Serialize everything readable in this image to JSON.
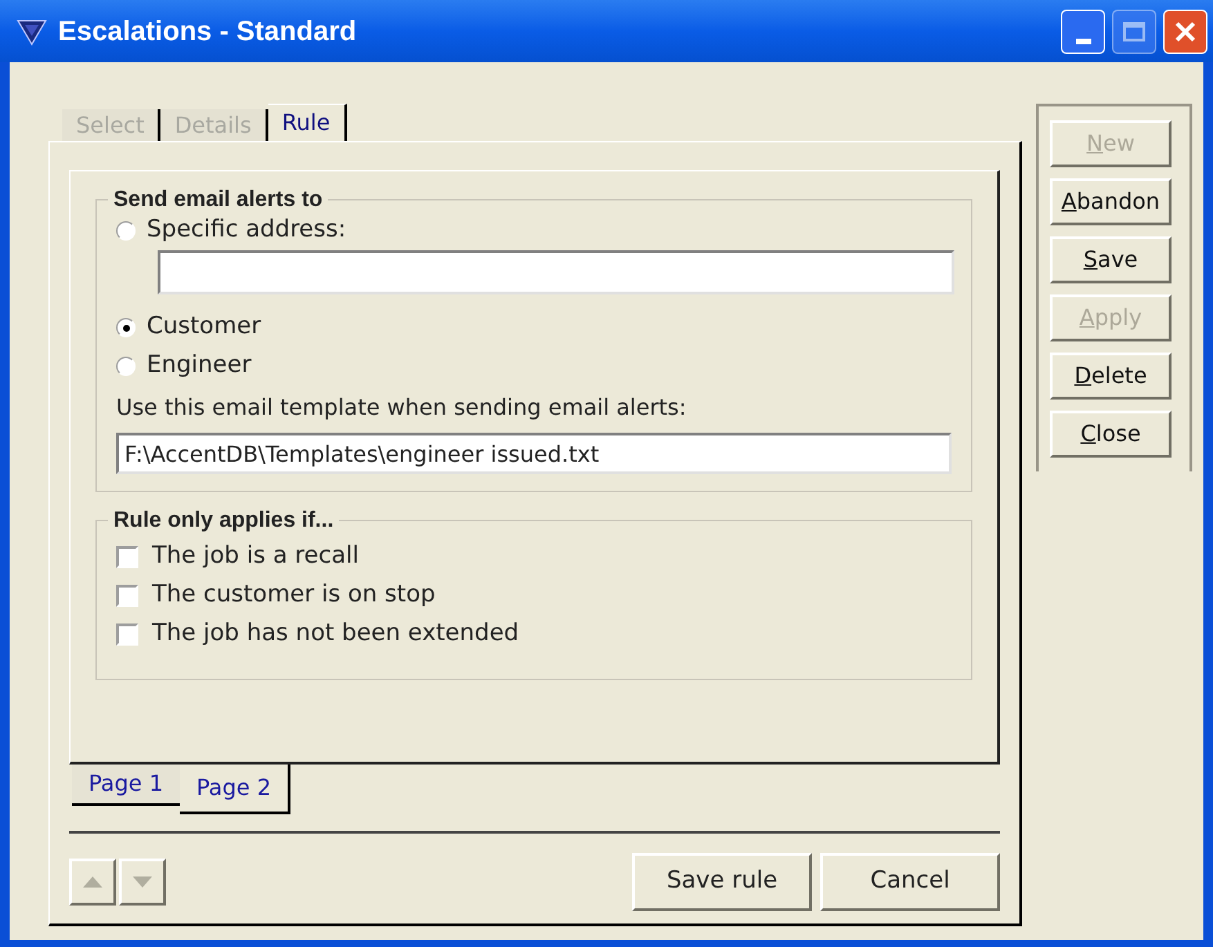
{
  "window": {
    "title": "Escalations - Standard"
  },
  "tabs": [
    {
      "label": "Select",
      "selected": false,
      "disabled": true
    },
    {
      "label": "Details",
      "selected": false,
      "disabled": true
    },
    {
      "label": "Rule",
      "selected": true,
      "disabled": false
    }
  ],
  "send_group": {
    "title": "Send email alerts to",
    "options": [
      {
        "label": "Specific address:",
        "selected": false
      },
      {
        "label": "Customer",
        "selected": true
      },
      {
        "label": "Engineer",
        "selected": false
      }
    ],
    "template_label": "Use this email template when sending email alerts:",
    "template_value": "F:\\AccentDB\\Templates\\engineer issued.txt"
  },
  "rule_group": {
    "title": "Rule only applies if...",
    "conditions": [
      {
        "label": "The job is a recall",
        "checked": false
      },
      {
        "label": "The customer is on stop",
        "checked": false
      },
      {
        "label": "The job has not been extended",
        "checked": false
      }
    ]
  },
  "page_tabs": [
    {
      "label": "Page 1",
      "selected": false
    },
    {
      "label": "Page 2",
      "selected": true
    }
  ],
  "bottom_buttons": [
    "Save rule",
    "Cancel"
  ],
  "side_buttons": [
    {
      "key": "N",
      "rest": "ew",
      "disabled": true
    },
    {
      "key": "A",
      "rest": "bandon",
      "disabled": false
    },
    {
      "key": "S",
      "rest": "ave",
      "disabled": false
    },
    {
      "key": "A",
      "rest": "pply",
      "disabled": true
    },
    {
      "key": "D",
      "rest": "elete",
      "disabled": false
    },
    {
      "key": "C",
      "rest": "lose",
      "disabled": false
    }
  ]
}
